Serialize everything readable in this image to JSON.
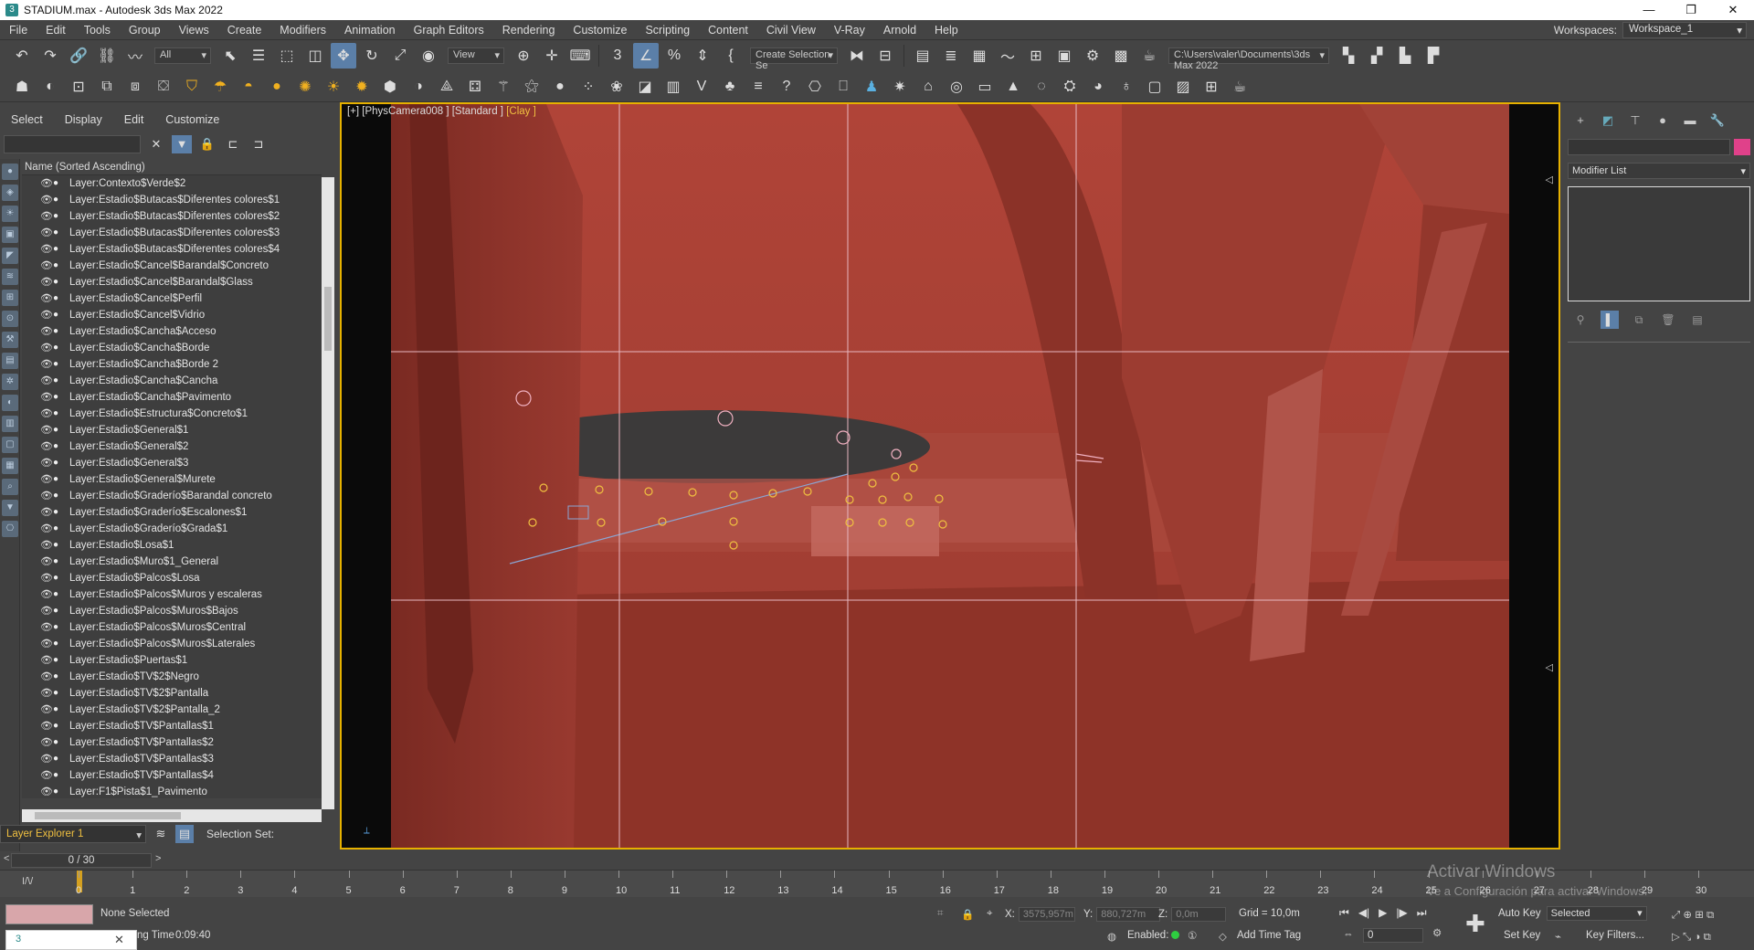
{
  "window": {
    "title": "STADIUM.max - Autodesk 3ds Max 2022",
    "min": "—",
    "max": "❐",
    "close": "✕"
  },
  "menu": {
    "items": [
      "File",
      "Edit",
      "Tools",
      "Group",
      "Views",
      "Create",
      "Modifiers",
      "Animation",
      "Graph Editors",
      "Rendering",
      "Customize",
      "Scripting",
      "Content",
      "Civil View",
      "V-Ray",
      "Arnold",
      "Help"
    ],
    "workspace_label": "Workspaces:",
    "workspace_value": "Workspace_1"
  },
  "toolbar": {
    "filter_value": "All",
    "refcoord_value": "View",
    "selection_set": "Create Selection Se",
    "project_path": "C:\\Users\\valer\\Documents\\3ds Max 2022"
  },
  "scene_explorer": {
    "menu": [
      "Select",
      "Display",
      "Edit",
      "Customize"
    ],
    "column_header": "Name (Sorted Ascending)",
    "layers": [
      "Layer:Contexto$Verde$2",
      "Layer:Estadio$Butacas$Diferentes colores$1",
      "Layer:Estadio$Butacas$Diferentes colores$2",
      "Layer:Estadio$Butacas$Diferentes colores$3",
      "Layer:Estadio$Butacas$Diferentes colores$4",
      "Layer:Estadio$Cancel$Barandal$Concreto",
      "Layer:Estadio$Cancel$Barandal$Glass",
      "Layer:Estadio$Cancel$Perfil",
      "Layer:Estadio$Cancel$Vidrio",
      "Layer:Estadio$Cancha$Acceso",
      "Layer:Estadio$Cancha$Borde",
      "Layer:Estadio$Cancha$Borde 2",
      "Layer:Estadio$Cancha$Cancha",
      "Layer:Estadio$Cancha$Pavimento",
      "Layer:Estadio$Estructura$Concreto$1",
      "Layer:Estadio$General$1",
      "Layer:Estadio$General$2",
      "Layer:Estadio$General$3",
      "Layer:Estadio$General$Murete",
      "Layer:Estadio$Graderío$Barandal concreto",
      "Layer:Estadio$Graderío$Escalones$1",
      "Layer:Estadio$Graderío$Grada$1",
      "Layer:Estadio$Losa$1",
      "Layer:Estadio$Muro$1_General",
      "Layer:Estadio$Palcos$Losa",
      "Layer:Estadio$Palcos$Muros y escaleras",
      "Layer:Estadio$Palcos$Muros$Bajos",
      "Layer:Estadio$Palcos$Muros$Central",
      "Layer:Estadio$Palcos$Muros$Laterales",
      "Layer:Estadio$Puertas$1",
      "Layer:Estadio$TV$2$Negro",
      "Layer:Estadio$TV$2$Pantalla",
      "Layer:Estadio$TV$2$Pantalla_2",
      "Layer:Estadio$TV$Pantallas$1",
      "Layer:Estadio$TV$Pantallas$2",
      "Layer:Estadio$TV$Pantallas$3",
      "Layer:Estadio$TV$Pantallas$4",
      "Layer:F1$Pista$1_Pavimento",
      "Layer:F1$Pista$2_Borde"
    ],
    "explorer_name": "Layer Explorer 1",
    "selection_set_label": "Selection Set:"
  },
  "viewport": {
    "label_prefix": "[+] [PhysCamera008 ] [Standard ]",
    "label_shading": "[Clay ]"
  },
  "command_panel": {
    "modifier_list": "Modifier List",
    "color": "#e0418a"
  },
  "timeline": {
    "frame_counter": "0 / 30",
    "ticks": [
      "0",
      "1",
      "2",
      "3",
      "4",
      "5",
      "6",
      "7",
      "8",
      "9",
      "10",
      "11",
      "12",
      "13",
      "14",
      "15",
      "16",
      "17",
      "18",
      "19",
      "20",
      "21",
      "22",
      "23",
      "24",
      "25",
      "26",
      "27",
      "28",
      "29",
      "30"
    ]
  },
  "status": {
    "selection": "None Selected",
    "render_time_prefix": "ng Time",
    "render_time": "0:09:40",
    "x_label": "X:",
    "x_value": "3575,957m",
    "y_label": "Y:",
    "y_value": "880,727m",
    "z_label": "Z:",
    "z_value": "0,0m",
    "grid": "Grid = 10,0m",
    "enabled_label": "Enabled:",
    "add_time_tag": "Add Time Tag",
    "auto_key": "Auto Key",
    "auto_key_mode": "Selected",
    "set_key": "Set Key",
    "key_filters": "Key Filters...",
    "frame_value": "0"
  },
  "watermark": {
    "line1": "Activar Windows",
    "line2": "Ve a Configuración para activar Windows."
  }
}
